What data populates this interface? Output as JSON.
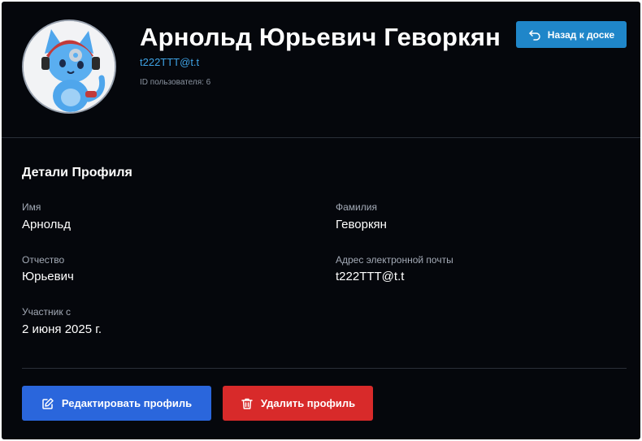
{
  "profile": {
    "full_name": "Арнольд Юрьевич Геворкян",
    "email": "t222TTT@t.t",
    "user_id_text": "ID пользователя: 6"
  },
  "header": {
    "back_label": "Назад к доске"
  },
  "details": {
    "title": "Детали Профиля",
    "first_name_label": "Имя",
    "first_name_value": "Арнольд",
    "last_name_label": "Фамилия",
    "last_name_value": "Геворкян",
    "patronymic_label": "Отчество",
    "patronymic_value": "Юрьевич",
    "email_label": "Адрес электронной почты",
    "email_value": "t222TTT@t.t",
    "member_since_label": "Участник с",
    "member_since_value": "2 июня 2025 г."
  },
  "actions": {
    "edit_label": "Редактировать профиль",
    "delete_label": "Удалить профиль"
  },
  "icons": {
    "back": "undo-arrow-icon",
    "edit": "pencil-square-icon",
    "delete": "trash-icon"
  },
  "colors": {
    "background": "#05070c",
    "link": "#3ea2e4",
    "back_button": "#1f86c9",
    "edit_button": "#2a66dc",
    "delete_button": "#d82a2a"
  }
}
